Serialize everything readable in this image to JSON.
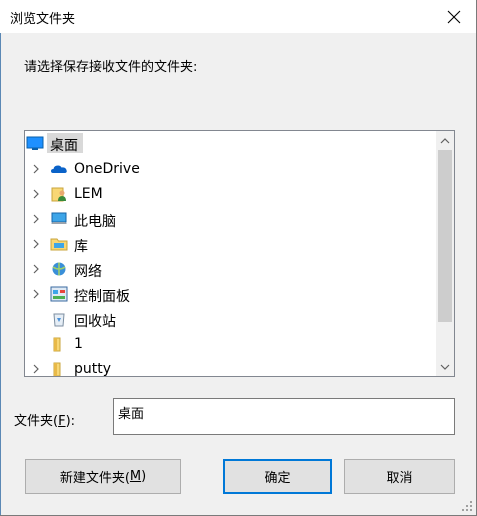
{
  "window": {
    "title": "浏览文件夹"
  },
  "prompt": "请选择保存接收文件的文件夹:",
  "tree": {
    "items": [
      {
        "label": "桌面",
        "icon": "desktop-icon",
        "expandable": false,
        "selected": true
      },
      {
        "label": "OneDrive",
        "icon": "onedrive-icon",
        "expandable": true
      },
      {
        "label": "LEM",
        "icon": "user-folder-icon",
        "expandable": true
      },
      {
        "label": "此电脑",
        "icon": "this-pc-icon",
        "expandable": true
      },
      {
        "label": "库",
        "icon": "library-icon",
        "expandable": true
      },
      {
        "label": "网络",
        "icon": "network-icon",
        "expandable": true
      },
      {
        "label": "控制面板",
        "icon": "control-panel-icon",
        "expandable": true
      },
      {
        "label": "回收站",
        "icon": "recycle-bin-icon",
        "expandable": false
      },
      {
        "label": "1",
        "icon": "folder-icon",
        "expandable": false
      },
      {
        "label": "putty",
        "icon": "folder-icon",
        "expandable": true
      }
    ]
  },
  "folder": {
    "label_prefix": "文件夹(",
    "label_key": "F",
    "label_suffix": "):",
    "value": "桌面"
  },
  "buttons": {
    "new_prefix": "新建文件夹(",
    "new_key": "M",
    "new_suffix": ")",
    "ok": "确定",
    "cancel": "取消"
  },
  "colors": {
    "accent": "#0078d7",
    "selection": "#d9d9d9",
    "folder": "#f8d775"
  }
}
